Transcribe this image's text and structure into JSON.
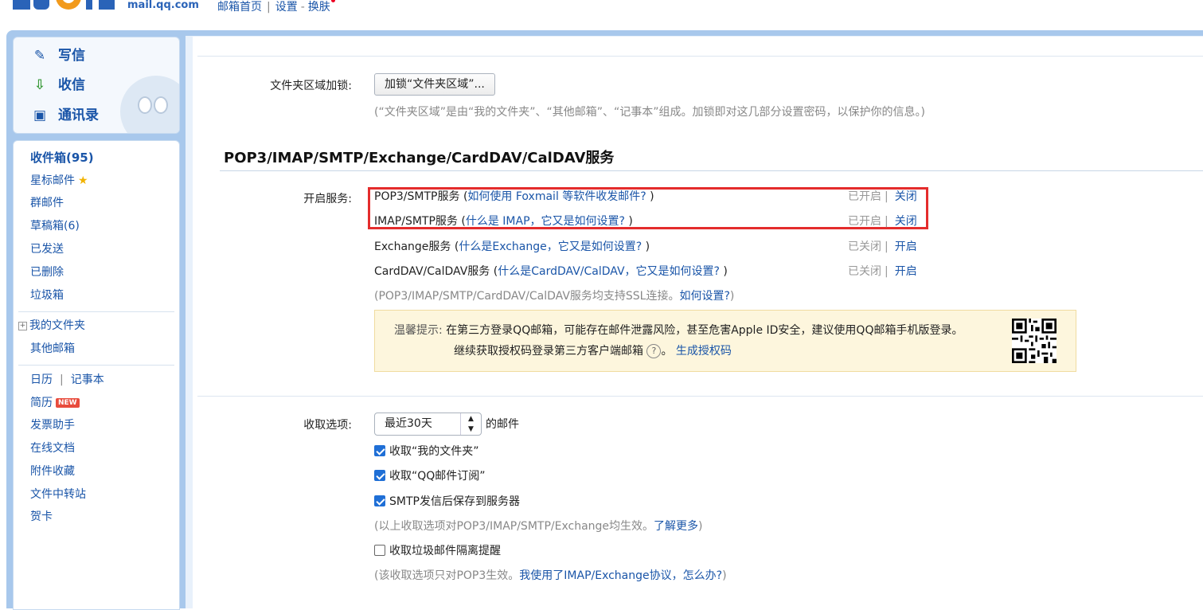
{
  "header": {
    "logo_domain": "mail.qq.com",
    "nav": [
      "邮箱首页",
      "设置",
      "换肤"
    ]
  },
  "compose": {
    "write": "写信",
    "receive": "收信",
    "contacts": "通讯录"
  },
  "sidebar": {
    "inbox": "收件箱(95)",
    "starred": "星标邮件",
    "group": "群邮件",
    "drafts": "草稿箱(6)",
    "sent": "已发送",
    "deleted": "已删除",
    "spam": "垃圾箱",
    "my_folders": "我的文件夹",
    "other_mailboxes": "其他邮箱",
    "calendar": "日历",
    "notes": "记事本",
    "resume": "简历",
    "resume_badge": "NEW",
    "invoice": "发票助手",
    "online_docs": "在线文档",
    "attachments": "附件收藏",
    "file_transfer": "文件中转站",
    "greeting_card": "贺卡"
  },
  "folder_lock": {
    "label": "文件夹区域加锁:",
    "button": "加锁“文件夹区域”...",
    "hint": "(“文件夹区域”是由“我的文件夹”、“其他邮箱”、“记事本”组成。加锁即对这几部分设置密码，以保护你的信息。)"
  },
  "services": {
    "title": "POP3/IMAP/SMTP/Exchange/CardDAV/CalDAV服务",
    "label": "开启服务:",
    "items": [
      {
        "name": "POP3/SMTP服务",
        "help": "如何使用 Foxmail 等软件收发邮件?",
        "status": "已开启",
        "action": "关闭"
      },
      {
        "name": "IMAP/SMTP服务",
        "help": "什么是 IMAP，它又是如何设置?",
        "status": "已开启",
        "action": "关闭"
      },
      {
        "name": "Exchange服务",
        "help": "什么是Exchange，它又是如何设置?",
        "status": "已关闭",
        "action": "开启"
      },
      {
        "name": "CardDAV/CalDAV服务",
        "help": "什么是CardDAV/CalDAV，它又是如何设置?",
        "status": "已关闭",
        "action": "开启"
      }
    ],
    "ssl_note": "(POP3/IMAP/SMTP/CardDAV/CalDAV服务均支持SSL连接。",
    "ssl_link": "如何设置?",
    "ssl_close": ")"
  },
  "tip": {
    "prefix": "温馨提示:",
    "line1": "在第三方登录QQ邮箱，可能存在邮件泄露风险，甚至危害Apple ID安全，建议使用QQ邮箱手机版登录。",
    "line2": "继续获取授权码登录第三方客户端邮箱",
    "help_icon": "?",
    "line2_end": "。",
    "link": "生成授权码"
  },
  "receive_options": {
    "label": "收取选项:",
    "select_value": "最近30天",
    "select_suffix": "的邮件",
    "opt1": "收取“我的文件夹”",
    "opt2": "收取“QQ邮件订阅”",
    "opt3": "SMTP发信后保存到服务器",
    "note1": "(以上收取选项对POP3/IMAP/SMTP/Exchange均生效。",
    "note1_link": "了解更多",
    "note1_end": ")",
    "opt4": "收取垃圾邮件隔离提醒",
    "note2": "(该收取选项只对POP3生效。",
    "note2_link": "我使用了IMAP/Exchange协议，怎么办?",
    "note2_end": ")"
  }
}
